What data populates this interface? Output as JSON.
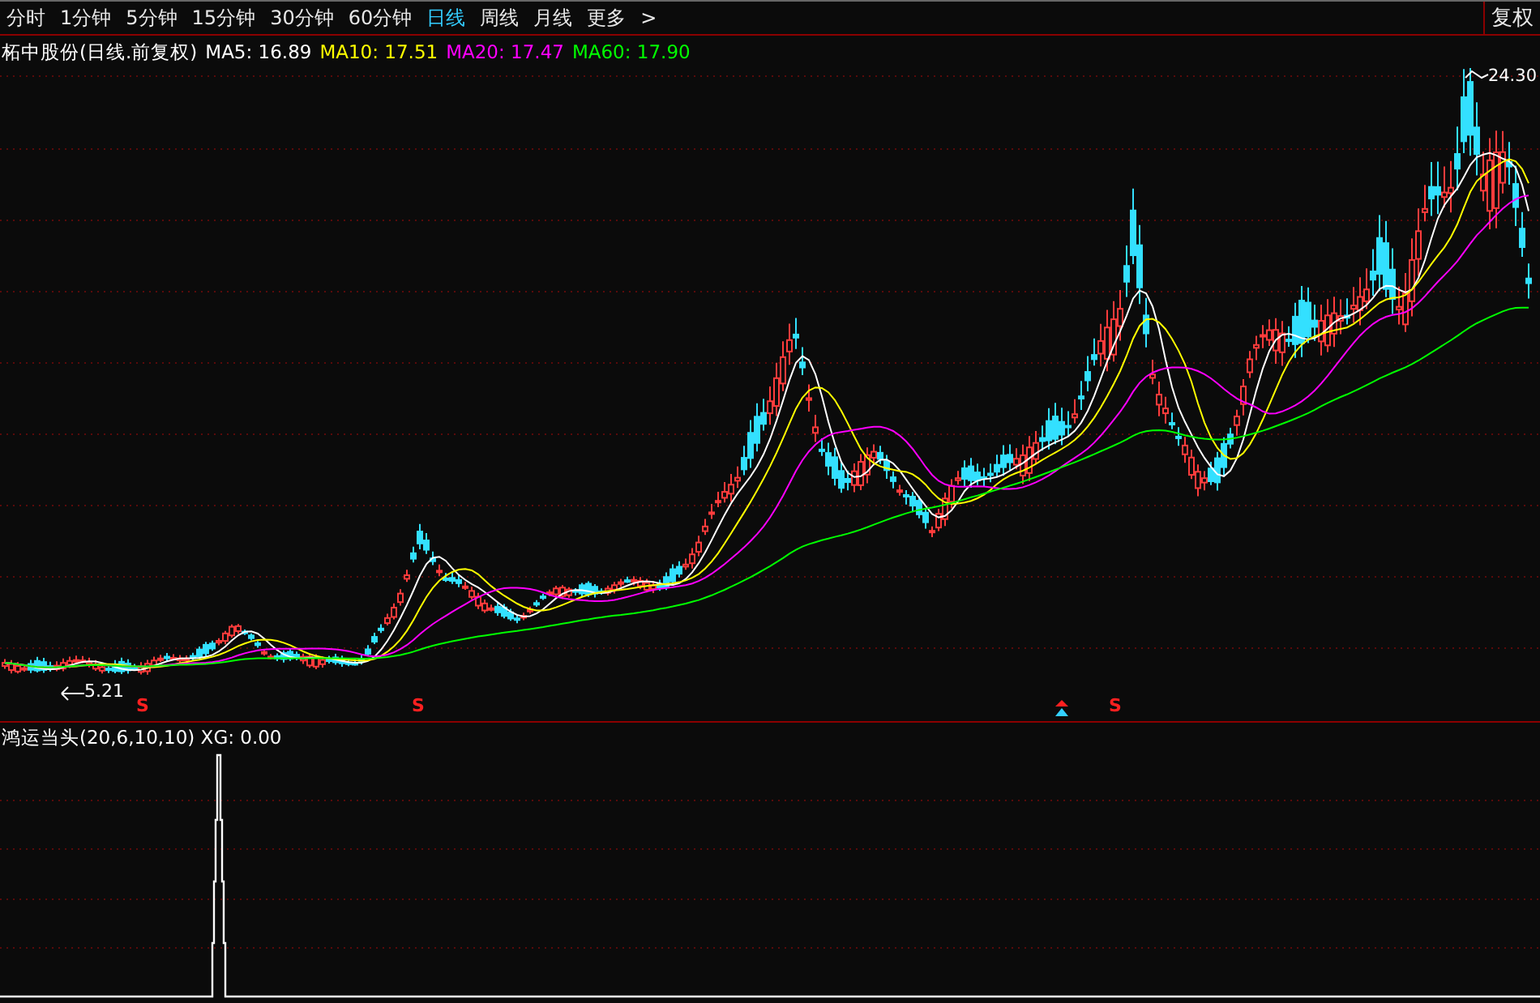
{
  "toolbar": {
    "tabs": [
      {
        "label": "分时",
        "selected": false
      },
      {
        "label": "1分钟",
        "selected": false
      },
      {
        "label": "5分钟",
        "selected": false
      },
      {
        "label": "15分钟",
        "selected": false
      },
      {
        "label": "30分钟",
        "selected": false
      },
      {
        "label": "60分钟",
        "selected": false
      },
      {
        "label": "日线",
        "selected": true
      },
      {
        "label": "周线",
        "selected": false
      },
      {
        "label": "月线",
        "selected": false
      },
      {
        "label": "更多",
        "selected": false
      }
    ],
    "more_arrow": ">",
    "right_button": "复权"
  },
  "legend": {
    "title": "柘中股份(日线.前复权)",
    "ma": [
      {
        "label": "MA5: 16.89",
        "color": "#ffffff"
      },
      {
        "label": "MA10: 17.51",
        "color": "#ffff00"
      },
      {
        "label": "MA20: 17.47",
        "color": "#ff00ff"
      },
      {
        "label": "MA60: 17.90",
        "color": "#00ff00"
      }
    ]
  },
  "price_chart": {
    "high_label": "24.30",
    "low_label": "5.21",
    "signals": [
      {
        "kind": "s",
        "text": "S"
      },
      {
        "kind": "s",
        "text": "S"
      },
      {
        "kind": "arrow"
      },
      {
        "kind": "s",
        "text": "S"
      }
    ]
  },
  "indicator": {
    "label": "鸿运当头(20,6,10,10) XG: 0.00"
  }
}
